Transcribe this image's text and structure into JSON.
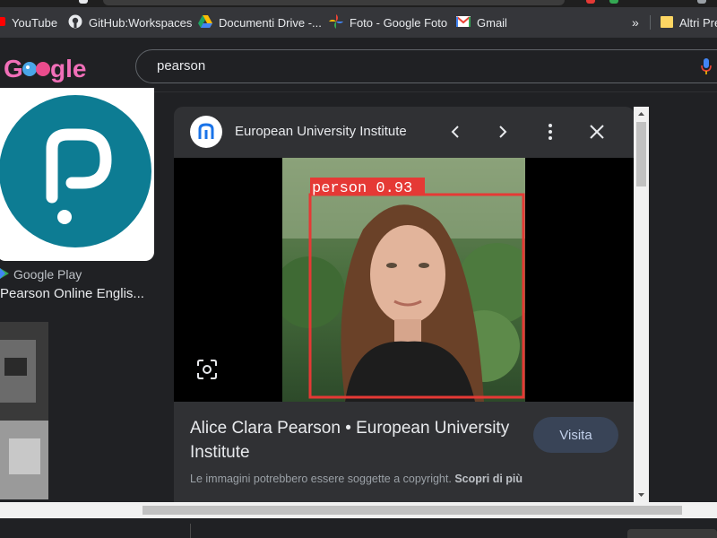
{
  "bookmarks": [
    {
      "label": "YouTube",
      "icon": "youtube-icon"
    },
    {
      "label": "GitHub:Workspaces",
      "icon": "github-icon"
    },
    {
      "label": "Documenti Drive -...",
      "icon": "google-drive-icon"
    },
    {
      "label": "Foto - Google Foto",
      "icon": "google-photos-icon"
    },
    {
      "label": "Gmail",
      "icon": "gmail-icon"
    },
    {
      "label": "»",
      "icon": "more-bookmarks-icon"
    },
    {
      "label": "Altri Pre",
      "icon": "folder-icon"
    }
  ],
  "header": {
    "logo": "Google",
    "search_query": "pearson"
  },
  "results": {
    "source": "Google Play",
    "title": "Pearson Online Englis..."
  },
  "panel": {
    "site_name": "European University Institute",
    "detection_label": "person 0.93",
    "image_title": "Alice Clara Pearson • European University Institute",
    "visit_label": "Visita",
    "copyright_text": "Le immagini potrebbero essere soggette a copyright.",
    "learn_more_label": "Scopri di più"
  },
  "colors": {
    "background": "#202124",
    "panel": "#303134",
    "pearson_teal": "#0d7c93",
    "detection_box": "#e53935",
    "visit_button": "#394457"
  }
}
